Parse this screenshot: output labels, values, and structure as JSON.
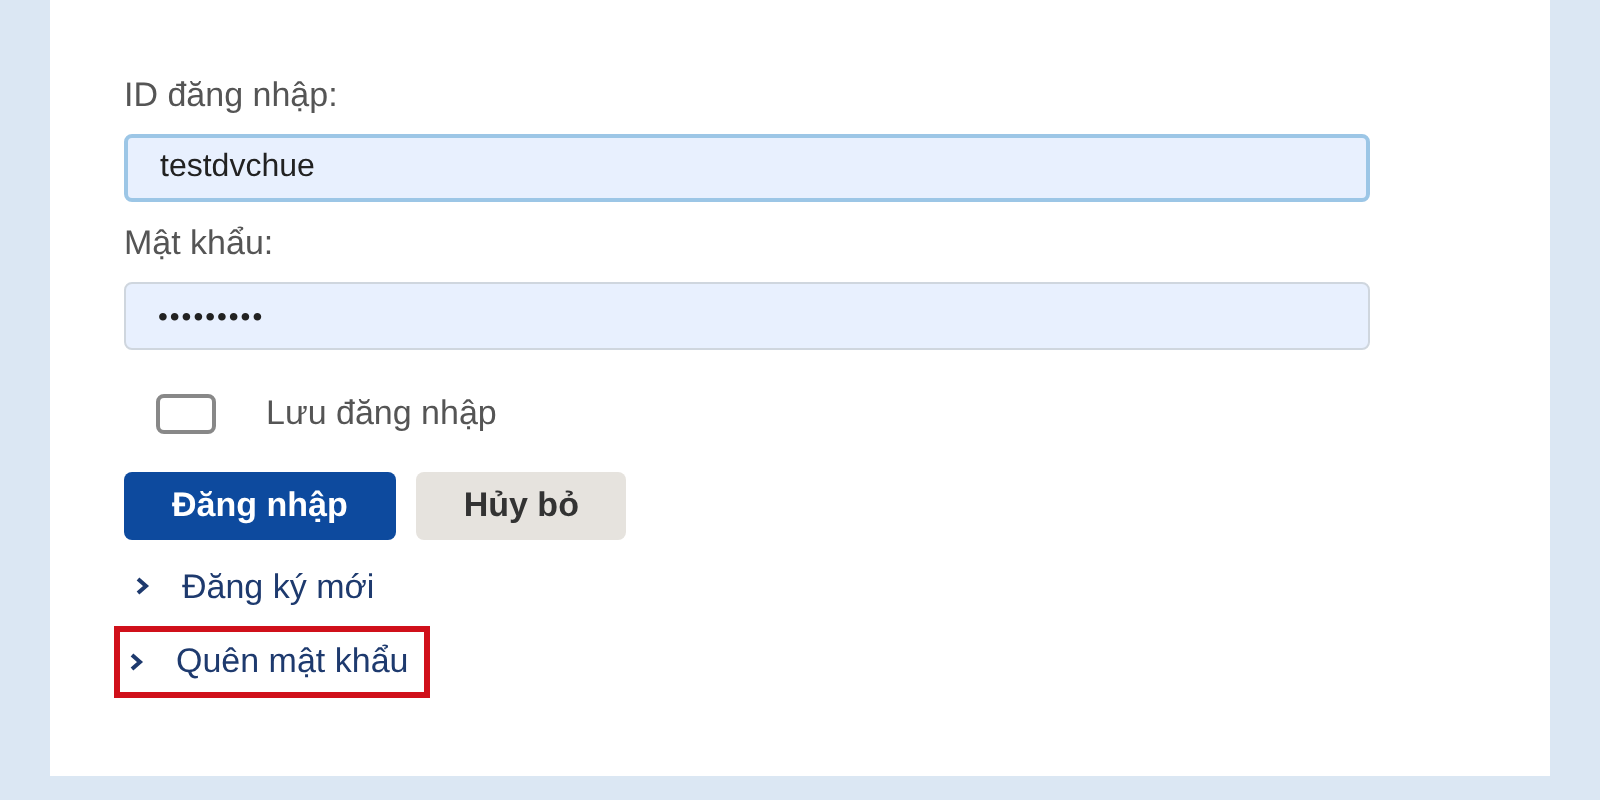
{
  "form": {
    "username_label": "ID đăng nhập:",
    "username_value": "testdvchue",
    "password_label": "Mật khẩu:",
    "password_value": "•••••••••",
    "remember": {
      "label": "Lưu đăng nhập",
      "checked": false
    },
    "buttons": [
      {
        "label": "Đăng nhập",
        "kind": "primary"
      },
      {
        "label": "Hủy bỏ",
        "kind": "secondary"
      }
    ],
    "links": [
      {
        "label": "Đăng ký mới",
        "highlighted": false
      },
      {
        "label": "Quên mật khẩu",
        "highlighted": true
      }
    ]
  }
}
